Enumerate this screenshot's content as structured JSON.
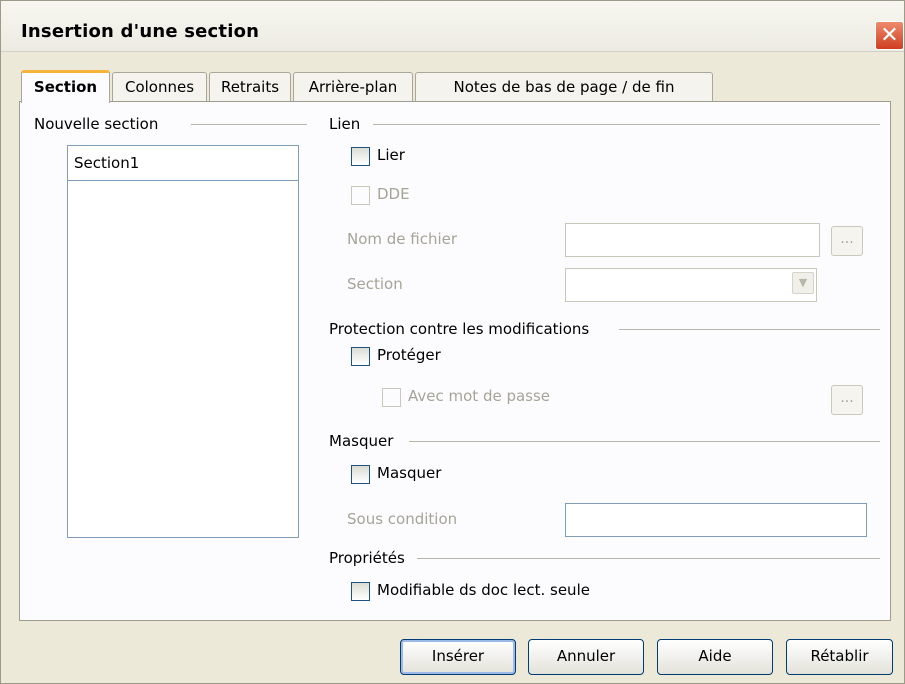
{
  "window": {
    "title": "Insertion d'une section",
    "close_glyph": "✕"
  },
  "tabs": [
    {
      "label": "Section",
      "active": true
    },
    {
      "label": "Colonnes",
      "active": false
    },
    {
      "label": "Retraits",
      "active": false
    },
    {
      "label": "Arrière-plan",
      "active": false
    },
    {
      "label": "Notes de bas de page / de fin",
      "active": false
    }
  ],
  "new_section": {
    "group_label": "Nouvelle section",
    "name_value": "Section1"
  },
  "link": {
    "group_label": "Lien",
    "link_checkbox": {
      "label": "Lier",
      "checked": false
    },
    "dde_checkbox": {
      "label": "DDE",
      "checked": false,
      "enabled": false
    },
    "filename_label": "Nom de fichier",
    "filename_value": "",
    "browse_label": "...",
    "section_label": "Section",
    "section_value": ""
  },
  "protection": {
    "group_label": "Protection contre les modifications",
    "protect_checkbox": {
      "label": "Protéger",
      "checked": false
    },
    "password_checkbox": {
      "label": "Avec mot de passe",
      "checked": false,
      "enabled": false
    },
    "password_button_label": "..."
  },
  "hide": {
    "group_label": "Masquer",
    "hide_checkbox": {
      "label": "Masquer",
      "checked": false
    },
    "condition_label": "Sous condition",
    "condition_value": ""
  },
  "properties": {
    "group_label": "Propriétés",
    "editable_checkbox": {
      "label": "Modifiable ds doc lect. seule",
      "checked": false
    }
  },
  "buttons": {
    "insert": "Insérer",
    "cancel": "Annuler",
    "help": "Aide",
    "reset": "Rétablir"
  },
  "colors": {
    "accent_tab": "#f6b339",
    "close_button": "#cf3e20",
    "input_border": "#7f9db9"
  }
}
